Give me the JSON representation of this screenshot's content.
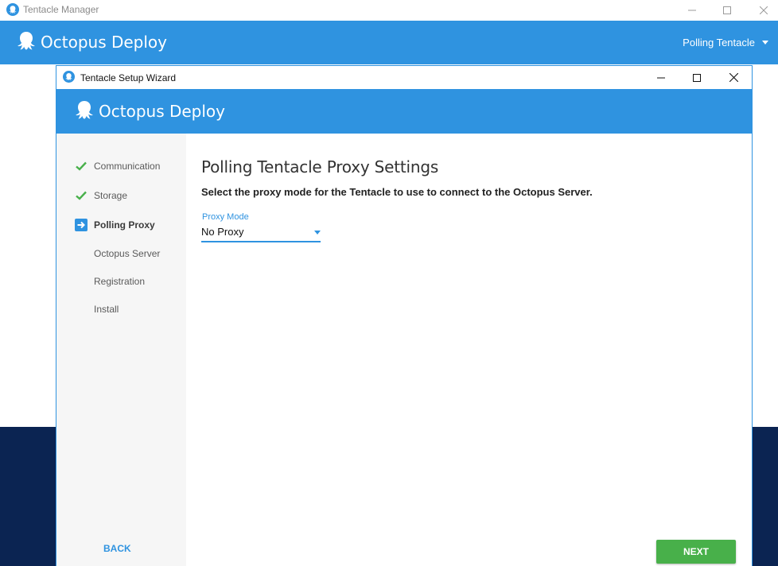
{
  "outer_window": {
    "title": "Tentacle Manager",
    "brand": "Octopus Deploy",
    "mode_selector": "Polling Tentacle"
  },
  "wizard": {
    "title": "Tentacle Setup Wizard",
    "brand": "Octopus Deploy",
    "steps": [
      {
        "label": "Communication",
        "status": "done"
      },
      {
        "label": "Storage",
        "status": "done"
      },
      {
        "label": "Polling Proxy",
        "status": "current"
      },
      {
        "label": "Octopus Server",
        "status": "pending"
      },
      {
        "label": "Registration",
        "status": "pending"
      },
      {
        "label": "Install",
        "status": "pending"
      }
    ],
    "page_title": "Polling Tentacle Proxy Settings",
    "page_subtitle": "Select the proxy mode for the Tentacle to use to connect to the Octopus Server.",
    "proxy_mode": {
      "label": "Proxy Mode",
      "value": "No Proxy"
    },
    "back_label": "BACK",
    "next_label": "NEXT"
  },
  "colors": {
    "brand_blue": "#2f93e0",
    "navy": "#0b2452",
    "success_green": "#48b04a"
  },
  "icons": {
    "app": "octopus-icon",
    "done": "checkmark-icon",
    "current": "arrow-right-icon",
    "dropdown": "caret-down-icon"
  }
}
